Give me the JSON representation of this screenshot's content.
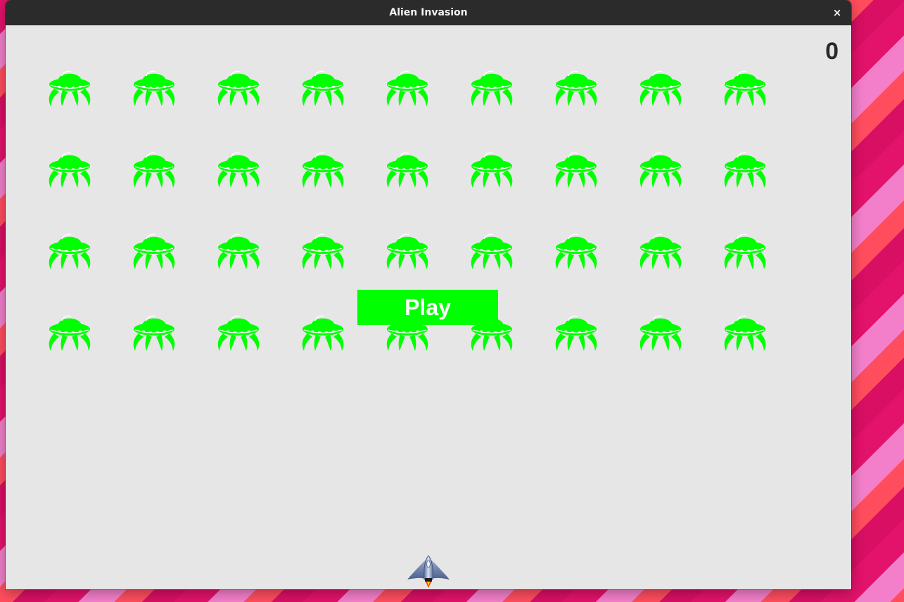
{
  "window": {
    "title": "Alien Invasion",
    "close_icon": "close-icon",
    "close_glyph": "×"
  },
  "game": {
    "score": "0",
    "play_button": {
      "label": "Play",
      "color": "#00ff00"
    },
    "alien_fleet": {
      "rows": 4,
      "columns": 9,
      "color": "#00ff00",
      "icon": "alien-ufo-icon"
    },
    "ship": {
      "icon": "rocket-ship-icon"
    },
    "background_color": "#e6e6e6"
  }
}
